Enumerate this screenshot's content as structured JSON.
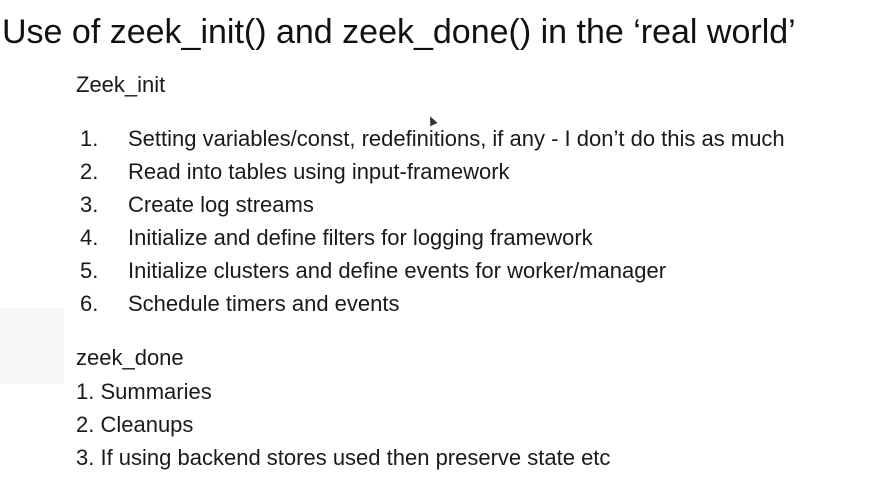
{
  "slide": {
    "title": "Use of zeek_init() and zeek_done() in the ‘real world’",
    "zeek_init": {
      "heading": "Zeek_init",
      "items": [
        {
          "num": "1.",
          "text": "Setting variables/const, redefinitions, if any - I don’t do this as much"
        },
        {
          "num": "2.",
          "text": "Read into tables using input-framework"
        },
        {
          "num": "3.",
          "text": "Create log streams"
        },
        {
          "num": "4.",
          "text": "Initialize and define filters for logging framework"
        },
        {
          "num": "5.",
          "text": "Initialize clusters and define events for worker/manager"
        },
        {
          "num": "6.",
          "text": "Schedule timers and events"
        }
      ]
    },
    "zeek_done": {
      "heading": "zeek_done",
      "items": [
        "1. Summaries",
        "2. Cleanups",
        "3. If using backend stores used then preserve state etc"
      ]
    }
  },
  "icons": {
    "cursor": "mouse-pointer-icon"
  }
}
